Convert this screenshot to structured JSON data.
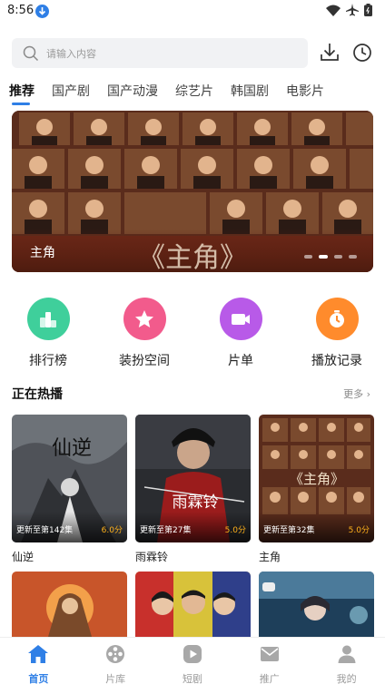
{
  "status_bar": {
    "time": "8:56"
  },
  "search": {
    "placeholder": "请输入内容"
  },
  "tabs": [
    {
      "label": "推荐"
    },
    {
      "label": "国产剧"
    },
    {
      "label": "国产动漫"
    },
    {
      "label": "综艺片"
    },
    {
      "label": "韩国剧"
    },
    {
      "label": "电影片"
    }
  ],
  "banner": {
    "caption": "主角",
    "watermark": "《主角》",
    "dot_count": 4,
    "active_dot": 1
  },
  "shortcuts": [
    {
      "label": "排行榜",
      "icon": "ranking-icon",
      "color": "#3fcf9b"
    },
    {
      "label": "装扮空间",
      "icon": "star-icon",
      "color": "#f25b8c"
    },
    {
      "label": "片单",
      "icon": "playlist-icon",
      "color": "#b85ae8"
    },
    {
      "label": "播放记录",
      "icon": "clock-icon",
      "color": "#ff8b2c"
    }
  ],
  "section": {
    "title": "正在热播",
    "more": "更多 ›"
  },
  "cards": [
    {
      "title": "仙逆",
      "update": "更新至第142集",
      "score": "6.0分",
      "poster_text": "仙逆"
    },
    {
      "title": "雨霖铃",
      "update": "更新至第27集",
      "score": "5.0分",
      "poster_text": "雨霖铃"
    },
    {
      "title": "主角",
      "update": "更新至第32集",
      "score": "5.0分",
      "poster_text": "《主角》"
    }
  ],
  "bottom_nav": [
    {
      "label": "首页",
      "icon": "home-icon",
      "active": true
    },
    {
      "label": "片库",
      "icon": "film-reel-icon",
      "active": false
    },
    {
      "label": "短剧",
      "icon": "play-icon",
      "active": false
    },
    {
      "label": "推广",
      "icon": "envelope-icon",
      "active": false
    },
    {
      "label": "我的",
      "icon": "user-icon",
      "active": false
    }
  ],
  "colors": {
    "accent": "#2f7fe6",
    "score": "#ffb11b",
    "inactive": "#9a9a9a"
  }
}
